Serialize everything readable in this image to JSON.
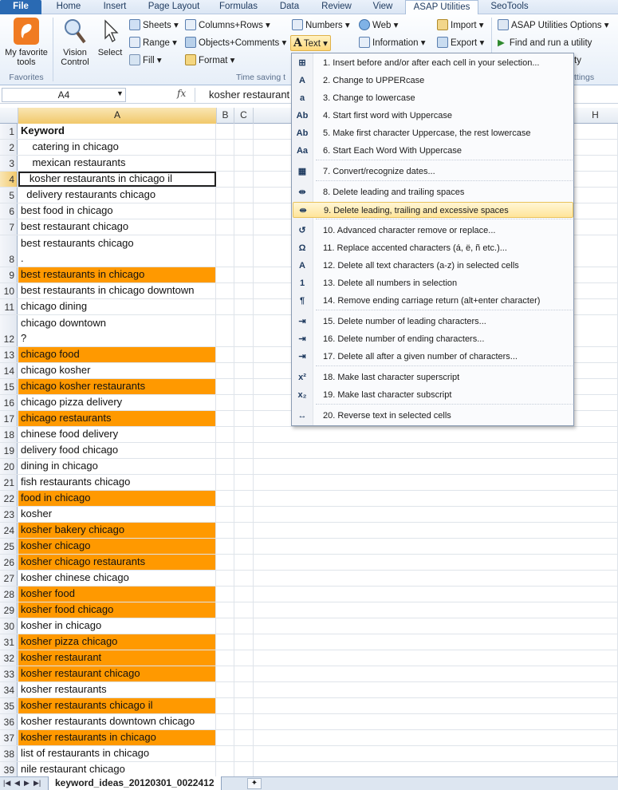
{
  "tabs": [
    {
      "label": "File"
    },
    {
      "label": "Home"
    },
    {
      "label": "Insert"
    },
    {
      "label": "Page Layout"
    },
    {
      "label": "Formulas"
    },
    {
      "label": "Data"
    },
    {
      "label": "Review"
    },
    {
      "label": "View"
    },
    {
      "label": "ASAP Utilities"
    },
    {
      "label": "SeoTools"
    }
  ],
  "ribbon": {
    "favorites_button": "My favorite tools",
    "favorites_group": "Favorites",
    "vision_control": "Vision Control",
    "select": "Select",
    "sheets": "Sheets",
    "range": "Range",
    "fill": "Fill",
    "columns_rows": "Columns+Rows",
    "objects_comments": "Objects+Comments",
    "format": "Format",
    "time_saving_group": "Time saving t",
    "numbers": "Numbers",
    "text": "Text",
    "web": "Web",
    "information": "Information",
    "import": "Import",
    "export": "Export",
    "asap_options": "ASAP Utilities Options",
    "find_run": "Find and run a utility",
    "partial_ty": "ty",
    "partial_settings": "ttings"
  },
  "formula_bar": {
    "name_box": "A4",
    "fx": "fx",
    "content": "kosher restaurant"
  },
  "columns": [
    "A",
    "B",
    "C",
    "H"
  ],
  "rows": [
    {
      "n": "1",
      "v": "Keyword",
      "bold": true
    },
    {
      "n": "2",
      "v": "    catering in chicago"
    },
    {
      "n": "3",
      "v": "    mexican restaurants"
    },
    {
      "n": "4",
      "v": "   kosher restaurants in chicago il",
      "active": true
    },
    {
      "n": "5",
      "v": "  delivery restaurants chicago"
    },
    {
      "n": "6",
      "v": "best food in chicago"
    },
    {
      "n": "7",
      "v": "best restaurant chicago"
    },
    {
      "n": "8",
      "v": "best restaurants chicago\n.",
      "tall": true
    },
    {
      "n": "9",
      "v": "best restaurants in chicago",
      "orange": true
    },
    {
      "n": "10",
      "v": "best restaurants in chicago downtown"
    },
    {
      "n": "11",
      "v": "chicago dining"
    },
    {
      "n": "12",
      "v": "chicago downtown\n?",
      "tall": true
    },
    {
      "n": "13",
      "v": "chicago food",
      "orange": true
    },
    {
      "n": "14",
      "v": "chicago kosher"
    },
    {
      "n": "15",
      "v": "chicago kosher restaurants",
      "orange": true
    },
    {
      "n": "16",
      "v": "chicago pizza delivery"
    },
    {
      "n": "17",
      "v": "chicago restaurants",
      "orange": true
    },
    {
      "n": "18",
      "v": "chinese food delivery"
    },
    {
      "n": "19",
      "v": "delivery food chicago"
    },
    {
      "n": "20",
      "v": "dining in chicago"
    },
    {
      "n": "21",
      "v": "fish restaurants chicago"
    },
    {
      "n": "22",
      "v": "food in chicago",
      "orange": true
    },
    {
      "n": "23",
      "v": "kosher"
    },
    {
      "n": "24",
      "v": "kosher bakery chicago",
      "orange": true
    },
    {
      "n": "25",
      "v": "kosher chicago",
      "orange": true
    },
    {
      "n": "26",
      "v": "kosher chicago restaurants",
      "orange": true
    },
    {
      "n": "27",
      "v": "kosher chinese chicago"
    },
    {
      "n": "28",
      "v": "kosher food",
      "orange": true
    },
    {
      "n": "29",
      "v": "kosher food chicago",
      "orange": true
    },
    {
      "n": "30",
      "v": "kosher in chicago"
    },
    {
      "n": "31",
      "v": "kosher pizza chicago",
      "orange": true
    },
    {
      "n": "32",
      "v": "kosher restaurant",
      "orange": true
    },
    {
      "n": "33",
      "v": "kosher restaurant chicago",
      "orange": true
    },
    {
      "n": "34",
      "v": "kosher restaurants"
    },
    {
      "n": "35",
      "v": "kosher restaurants chicago il",
      "orange": true
    },
    {
      "n": "36",
      "v": "kosher restaurants downtown chicago"
    },
    {
      "n": "37",
      "v": "kosher restaurants in chicago",
      "orange": true
    },
    {
      "n": "38",
      "v": "list of restaurants in chicago"
    },
    {
      "n": "39",
      "v": "nile restaurant chicago"
    }
  ],
  "menu": {
    "items": [
      {
        "icon": "⊞",
        "label": "1. Insert before and/or after each cell in your selection..."
      },
      {
        "icon": "A",
        "label": "2. Change to UPPERcase"
      },
      {
        "icon": "a",
        "label": "3. Change to lowercase"
      },
      {
        "icon": "Ab",
        "label": "4. Start first word with Uppercase"
      },
      {
        "icon": "Ab",
        "label": "5. Make first character Uppercase, the rest lowercase"
      },
      {
        "icon": "Aa",
        "label": "6. Start Each Word With Uppercase"
      },
      {
        "icon": "▦",
        "label": "7. Convert/recognize dates..."
      },
      {
        "icon": "⇹",
        "label": "8. Delete leading and trailing spaces"
      },
      {
        "icon": "⇹",
        "label": "9. Delete leading, trailing and excessive spaces"
      },
      {
        "icon": "↺",
        "label": "10. Advanced character remove or replace..."
      },
      {
        "icon": "Ω",
        "label": "11. Replace accented characters (á, ë, ñ etc.)..."
      },
      {
        "icon": "A",
        "label": "12. Delete all text characters (a-z) in selected cells"
      },
      {
        "icon": "1",
        "label": "13. Delete all numbers in selection"
      },
      {
        "icon": "¶",
        "label": "14. Remove ending carriage return (alt+enter character)"
      },
      {
        "icon": "⇥",
        "label": "15. Delete number of leading characters..."
      },
      {
        "icon": "⇥",
        "label": "16. Delete number of ending characters..."
      },
      {
        "icon": "⇥",
        "label": "17. Delete all after a given number of characters..."
      },
      {
        "icon": "x²",
        "label": "18. Make last character superscript"
      },
      {
        "icon": "x₂",
        "label": "19. Make last character subscript"
      },
      {
        "icon": "↔",
        "label": "20. Reverse text in selected cells"
      }
    ]
  },
  "sheet_tab": "keyword_ideas_20120301_0022412",
  "colors": {
    "highlight": "#ff9900",
    "file_tab": "#2a6ab3"
  }
}
